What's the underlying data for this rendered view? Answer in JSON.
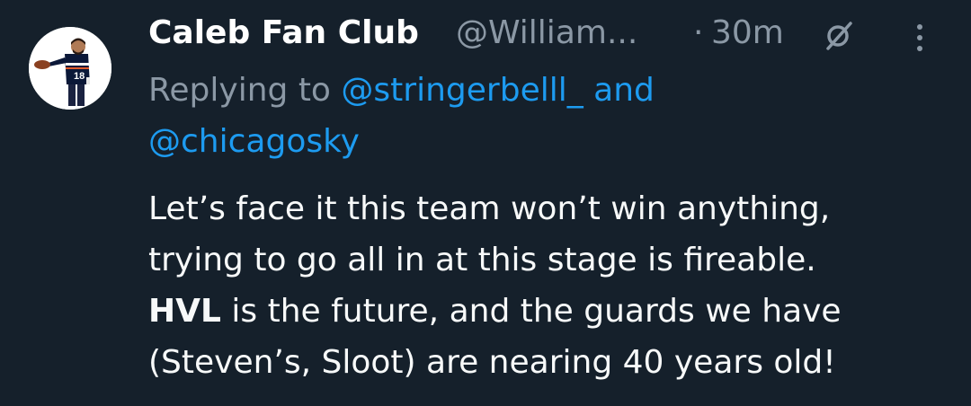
{
  "tweet": {
    "display_name": "Caleb Fan Club",
    "handle": "@William...",
    "separator": "·",
    "time": "30m",
    "reply_prefix": "Replying to",
    "mention_1": "@stringerbelll_",
    "reply_joiner": "and",
    "mention_2": "@chicagosky",
    "body_line_1": "Let’s face it this team won’t win anything,",
    "body_line_2": "trying to go all in at this stage is fireable.",
    "body_bold": "HVL",
    "body_line_3_rest": " is the future, and the guards we have",
    "body_line_4": "(Steven’s, Sloot) are nearing 40 years old!"
  },
  "colors": {
    "background": "#15202b",
    "text": "#f7f9f9",
    "muted": "#8b98a5",
    "link": "#1d9bf0"
  },
  "icons": {
    "grok": "grok-icon",
    "more": "more-options-icon",
    "avatar": "avatar-image"
  }
}
